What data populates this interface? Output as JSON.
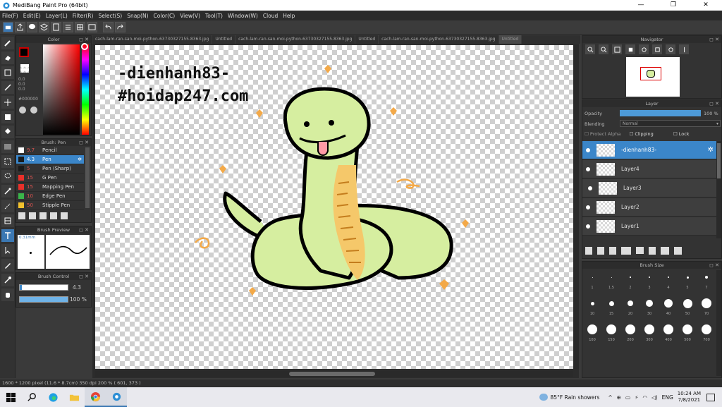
{
  "window": {
    "title": "MediBang Paint Pro (64bit)",
    "min": "—",
    "max": "❐",
    "close": "✕"
  },
  "menu": [
    "File(F)",
    "Edit(E)",
    "Layer(L)",
    "Filter(R)",
    "Select(S)",
    "Snap(N)",
    "Color(C)",
    "View(V)",
    "Tool(T)",
    "Window(W)",
    "Cloud",
    "Help"
  ],
  "tabs": [
    "cach-lam-ran-san-moi-python-63730327155.8363.jpg",
    "Untitled",
    "cach-lam-ran-san-moi-python-63730327155.8363.jpg",
    "Untitled",
    "cach-lam-ran-san-moi-python-63730327155.8363.jpg",
    "Untitled"
  ],
  "color_panel": {
    "title": "Color",
    "values": [
      "0.0",
      "0.0",
      "0.0"
    ],
    "hex": "#000000",
    "primary": "#000000",
    "secondary": "#ffffff"
  },
  "brush_panel": {
    "title": "Brush: Pen",
    "items": [
      {
        "size": "9.7",
        "name": "Pencil",
        "color": "#ffffff"
      },
      {
        "size": "4.3",
        "name": "Pen",
        "color": "#1a1a1a"
      },
      {
        "size": "5",
        "name": "Pen (Sharp)",
        "color": "#1a1a1a"
      },
      {
        "size": "15",
        "name": "G Pen",
        "color": "#e8302a"
      },
      {
        "size": "15",
        "name": "Mapping Pen",
        "color": "#e8302a"
      },
      {
        "size": "10",
        "name": "Edge Pen",
        "color": "#3ab54a"
      },
      {
        "size": "50",
        "name": "Stipple Pen",
        "color": "#f2c12e"
      }
    ]
  },
  "brush_preview": {
    "title": "Brush Preview",
    "size": "0.31mm"
  },
  "brush_control": {
    "title": "Brush Control",
    "size_value": "4.3",
    "opacity_value": "100 %",
    "size_fraction": 0.05,
    "opacity_fraction": 1.0
  },
  "canvas_text": {
    "line1": "-dienhanh83-",
    "line2": "#hoidap247.com"
  },
  "navigator": {
    "title": "Navigator"
  },
  "layer_panel": {
    "title": "Layer",
    "opacity_label": "Opacity",
    "opacity_value": "100 %",
    "opacity_fraction": 1.0,
    "blending_label": "Blending",
    "blending_value": "Normal",
    "protect_alpha": "Protect Alpha",
    "clipping": "Clipping",
    "lock": "Lock",
    "layers": [
      {
        "name": "-dienhanh83-",
        "selected": true
      },
      {
        "name": "Layer4",
        "selected": false
      },
      {
        "name": "Layer3",
        "selected": false
      },
      {
        "name": "Layer2",
        "selected": false
      },
      {
        "name": "Layer1",
        "selected": false
      }
    ]
  },
  "brush_size_panel": {
    "title": "Brush Size",
    "labels": [
      "1",
      "1.5",
      "2",
      "3",
      "4",
      "5",
      "7",
      "10",
      "15",
      "20",
      "30",
      "40",
      "50",
      "70",
      "100",
      "150",
      "200",
      "300",
      "400",
      "500",
      "700"
    ]
  },
  "status": {
    "text": "1600 * 1200 pixel  (11.6 * 8.7cm)  350 dpi  200 %  ( 601, 373 )"
  },
  "taskbar": {
    "weather": "85°F  Rain showers",
    "lang": "ENG",
    "time": "10:24 AM",
    "date": "7/8/2021"
  },
  "colors": {
    "accent": "#3b86c9",
    "snake_green": "#d6eea0",
    "snake_belly": "#f5c86a",
    "hearts": "#f3a948"
  }
}
